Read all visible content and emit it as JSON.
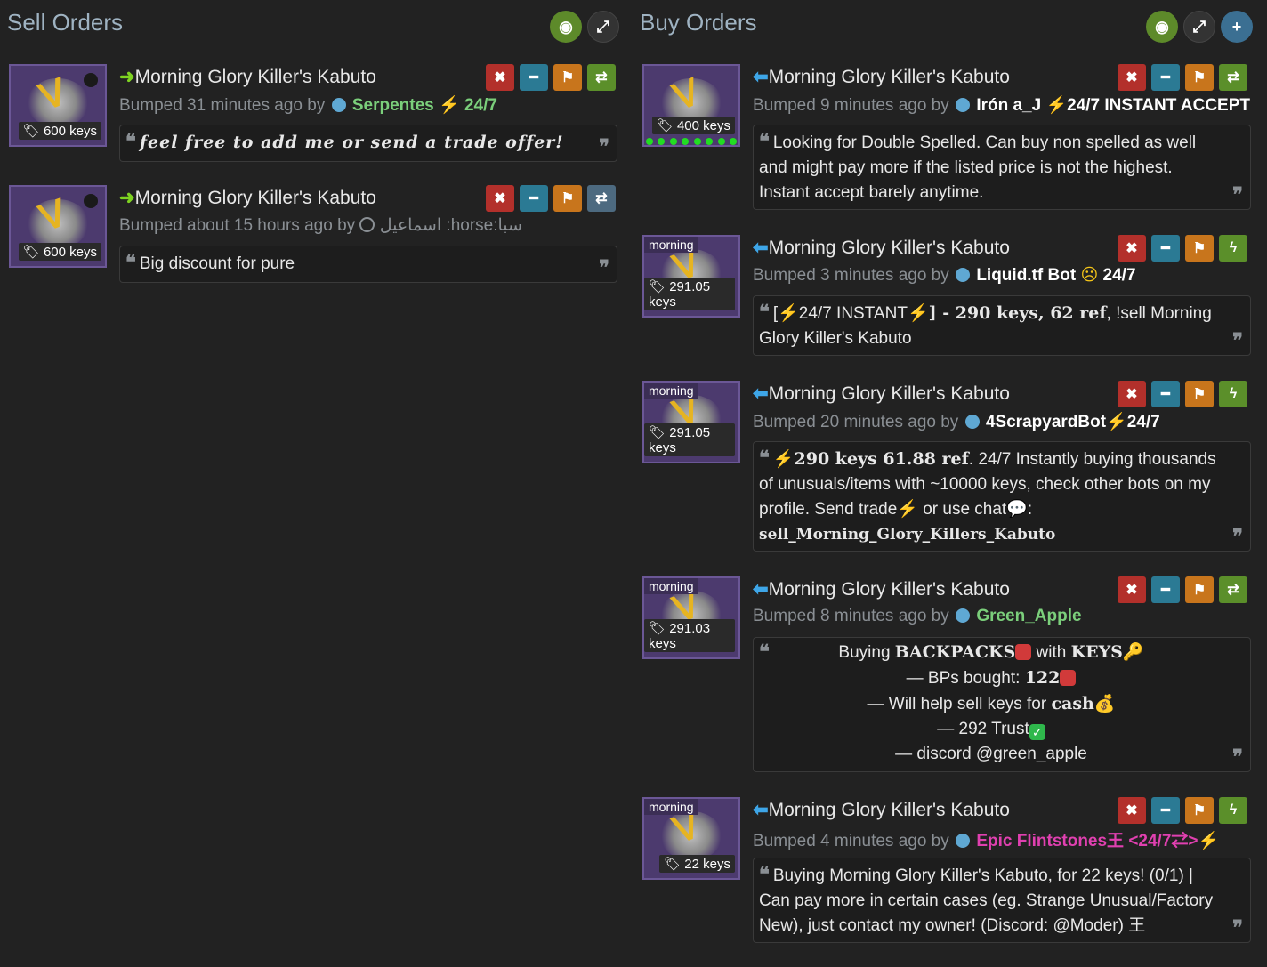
{
  "sell": {
    "title": "Sell Orders",
    "listings": [
      {
        "item": "Morning Glory Killer's Kabuto",
        "price": "600 keys",
        "bumped": "Bumped 31 minutes ago by",
        "user": "Serpentes",
        "user_suffix": "⚡ 24/7",
        "comment": "feel free to add me or send a trade offer!"
      },
      {
        "item": "Morning Glory Killer's Kabuto",
        "price": "600 keys",
        "bumped": "Bumped about 15 hours ago by",
        "user": "اسماعيل :horse:سبا",
        "comment": "Big discount for pure"
      }
    ]
  },
  "buy": {
    "title": "Buy Orders",
    "listings": [
      {
        "item": "Morning Glory Killer's Kabuto",
        "price": "400 keys",
        "bumped": "Bumped 9 minutes ago by",
        "user": "Irón a_J",
        "user_suffix": "24/7 INSTANT ACCEPT",
        "comment": "Looking for Double Spelled. Can buy non spelled as well and might pay more if the listed price is not the highest. Instant accept barely anytime."
      },
      {
        "tag": "morning",
        "item": "Morning Glory Killer's Kabuto",
        "price": "291.05 keys",
        "bumped": "Bumped 3 minutes ago by",
        "user": "Liquid.tf Bot",
        "user_suffix": "24/7",
        "comment_a": "[",
        "comment_b": "24/7 INSTANT",
        "comment_c": "] - 290 keys, 62 ref",
        "comment_d": ", !sell Morning Glory Killer's Kabuto"
      },
      {
        "tag": "morning",
        "item": "Morning Glory Killer's Kabuto",
        "price": "291.05 keys",
        "bumped": "Bumped 20 minutes ago by",
        "user": "4ScrapyardBot",
        "user_suffix": "24/7",
        "comment_a": "290 keys 61.88 ref",
        "comment_b": ". 24/7 Instantly buying thousands of unusuals/items with ~10000 keys, check other bots on my profile. Send trade",
        "comment_c": " or use chat",
        "comment_d": ":",
        "comment_e": "sell_Morning_Glory_Killers_Kabuto"
      },
      {
        "tag": "morning",
        "item": "Morning Glory Killer's Kabuto",
        "price": "291.03 keys",
        "bumped": "Bumped 8 minutes ago by",
        "user": "Green_Apple",
        "lines": {
          "l1a": "Buying ",
          "l1b": "BACKPACKS",
          "l1c": " with ",
          "l1d": "KEYS",
          "l2a": "— BPs bought: ",
          "l2b": "122",
          "l3a": "— Will help sell keys for ",
          "l3b": "cash",
          "l4": "— 292 Trust",
          "l5": "— discord @green_apple"
        }
      },
      {
        "tag": "morning",
        "item": "Morning Glory Killer's Kabuto",
        "price": "22 keys",
        "bumped": "Bumped 4 minutes ago by",
        "user": "Epic Flintstones王 <24/7⇄>",
        "comment": "Buying Morning Glory Killer's Kabuto, for 22 keys! (0/1) | Can pay more in certain cases (eg. Strange Unusual/Factory New), just contact my owner! (Discord: @Moder) 王"
      }
    ]
  },
  "icons": {
    "eye": "eye-slash-icon",
    "expand": "expand-icon",
    "add": "plus-icon",
    "remove": "close-icon",
    "minus": "minus-icon",
    "flag": "flag-icon",
    "trade": "exchange-icon",
    "bolt": "bolt-icon"
  },
  "colors": {
    "background": "#222222",
    "sell_arrow": "#7ed321",
    "buy_arrow": "#3ea6e8",
    "btn_red": "#b3302b",
    "btn_teal": "#2b7a94",
    "btn_orange": "#c8751c",
    "btn_green": "#5b8f2a"
  }
}
